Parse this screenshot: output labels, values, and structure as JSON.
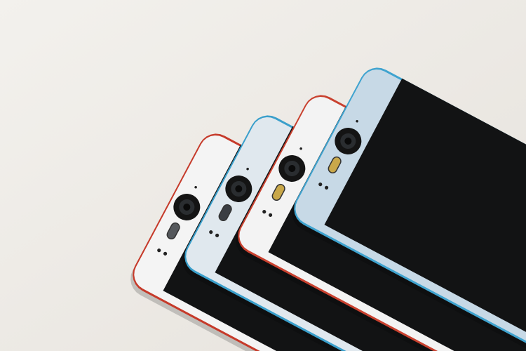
{
  "scene": {
    "background_top": "#f3f1ed",
    "background_bottom": "#e6e2dc",
    "phones": [
      {
        "edge_color": "#c63a2a",
        "band_color": "#f4f4f4",
        "flash_color": "#55585c"
      },
      {
        "edge_color": "#3a9fcb",
        "band_color": "#e0e8ee",
        "flash_color": "#3a3d42"
      },
      {
        "edge_color": "#c9412f",
        "band_color": "#f3f3f3",
        "flash_color": "#c9a84a"
      },
      {
        "edge_color": "#3fa3cf",
        "band_color": "#c7d9e6",
        "flash_color": "#c9a84a"
      }
    ],
    "screen_color": "#121314"
  }
}
